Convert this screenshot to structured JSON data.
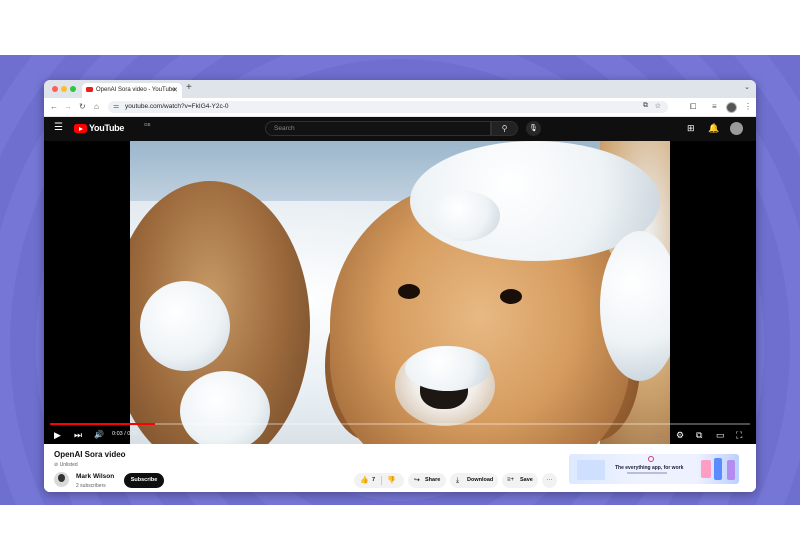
{
  "browser": {
    "tab_title": "OpenAI Sora video - YouTube",
    "new_tab": "+",
    "tab_close": "✕",
    "tab_menu": "⌄",
    "url": "youtube.com/watch?v=FkIG4-Y2c-0",
    "nav": {
      "back": "←",
      "forward": "→",
      "reload": "↻",
      "home": "⌂"
    },
    "icons": [
      "tune-icon",
      "install-icon",
      "bookmark-star-icon",
      "extensions-icon",
      "media-controls-icon",
      "profile-avatar",
      "kebab-menu-icon"
    ]
  },
  "youtube": {
    "header": {
      "menu": "☰",
      "logo_text": "YouTube",
      "country_code": "GB",
      "search_placeholder": "Search",
      "search_icon": "⚲",
      "mic_icon": "🎙",
      "create_icon": "⊞",
      "bell_icon": "🔔"
    },
    "player": {
      "time": "0:03 / 0:20",
      "progress": 0.15,
      "play_icon": "▶",
      "next_icon": "⏭",
      "volume_icon": "🔊",
      "subtitles_icon": "▭",
      "settings_icon": "⚙",
      "miniplayer_icon": "⧉",
      "theater_icon": "▭",
      "fullscreen_icon": "⛶"
    },
    "video": {
      "title": "OpenAI Sora video",
      "visibility": "Unlisted"
    },
    "channel": {
      "name": "Mark Wilson",
      "subscribers": "2 subscribers",
      "subscribe_label": "Subscribe"
    },
    "actions": {
      "like_count": "7",
      "like_icon": "👍",
      "dislike_icon": "👎",
      "share": "Share",
      "share_icon": "↪",
      "download": "Download",
      "download_icon": "⤓",
      "save": "Save",
      "save_icon": "≡+",
      "more": "···"
    },
    "ad": {
      "headline": "The everything app, for work"
    }
  },
  "colors": {
    "background_band": "#7373d4",
    "youtube_red": "#ff0000",
    "header_bg": "#0f0f0f"
  }
}
